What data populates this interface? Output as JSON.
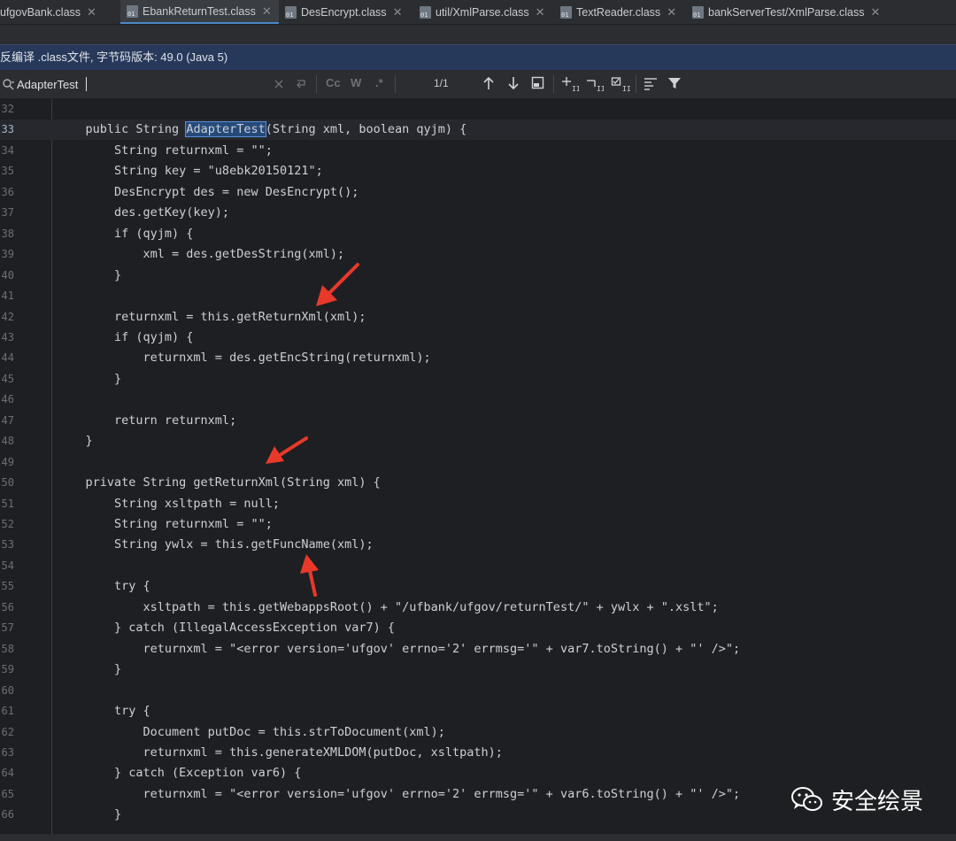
{
  "tabs": [
    {
      "label": "ufgovBank.class",
      "active": false
    },
    {
      "label": "EbankReturnTest.class",
      "active": true
    },
    {
      "label": "DesEncrypt.class",
      "active": false
    },
    {
      "label": "util/XmlParse.class",
      "active": false
    },
    {
      "label": "TextReader.class",
      "active": false
    },
    {
      "label": "bankServerTest/XmlParse.class",
      "active": false
    }
  ],
  "file_icon_label": "01",
  "close_glyph": "✕",
  "banner": "反编译 .class文件, 字节码版本: 49.0 (Java 5)",
  "search": {
    "value": "AdapterTest",
    "match_case": "Cc",
    "whole_words": "W",
    "regex": ".*",
    "result_count": "1/1"
  },
  "code_lines": [
    {
      "num": "32",
      "text": ""
    },
    {
      "num": "33",
      "text": "    public String ",
      "match": "AdapterTest",
      "after": "(String xml, boolean qyjm) {"
    },
    {
      "num": "34",
      "text": "        String returnxml = \"\";"
    },
    {
      "num": "35",
      "text": "        String key = \"u8ebk20150121\";"
    },
    {
      "num": "36",
      "text": "        DesEncrypt des = new DesEncrypt();"
    },
    {
      "num": "37",
      "text": "        des.getKey(key);"
    },
    {
      "num": "38",
      "text": "        if (qyjm) {"
    },
    {
      "num": "39",
      "text": "            xml = des.getDesString(xml);"
    },
    {
      "num": "40",
      "text": "        }"
    },
    {
      "num": "41",
      "text": ""
    },
    {
      "num": "42",
      "text": "        returnxml = this.getReturnXml(xml);"
    },
    {
      "num": "43",
      "text": "        if (qyjm) {"
    },
    {
      "num": "44",
      "text": "            returnxml = des.getEncString(returnxml);"
    },
    {
      "num": "45",
      "text": "        }"
    },
    {
      "num": "46",
      "text": ""
    },
    {
      "num": "47",
      "text": "        return returnxml;"
    },
    {
      "num": "48",
      "text": "    }"
    },
    {
      "num": "49",
      "text": ""
    },
    {
      "num": "50",
      "text": "    private String getReturnXml(String xml) {"
    },
    {
      "num": "51",
      "text": "        String xsltpath = null;"
    },
    {
      "num": "52",
      "text": "        String returnxml = \"\";"
    },
    {
      "num": "53",
      "text": "        String ywlx = this.getFuncName(xml);"
    },
    {
      "num": "54",
      "text": ""
    },
    {
      "num": "55",
      "text": "        try {"
    },
    {
      "num": "56",
      "text": "            xsltpath = this.getWebappsRoot() + \"/ufbank/ufgov/returnTest/\" + ywlx + \".xslt\";"
    },
    {
      "num": "57",
      "text": "        } catch (IllegalAccessException var7) {"
    },
    {
      "num": "58",
      "text": "            returnxml = \"<error version='ufgov' errno='2' errmsg='\" + var7.toString() + \"' />\";"
    },
    {
      "num": "59",
      "text": "        }"
    },
    {
      "num": "60",
      "text": ""
    },
    {
      "num": "61",
      "text": "        try {"
    },
    {
      "num": "62",
      "text": "            Document putDoc = this.strToDocument(xml);"
    },
    {
      "num": "63",
      "text": "            returnxml = this.generateXMLDOM(putDoc, xsltpath);"
    },
    {
      "num": "64",
      "text": "        } catch (Exception var6) {"
    },
    {
      "num": "65",
      "text": "            returnxml = \"<error version='ufgov' errno='2' errmsg='\" + var6.toString() + \"' />\";"
    },
    {
      "num": "66",
      "text": "        }"
    }
  ],
  "watermark": "安全绘景",
  "colors": {
    "background": "#1e1f22",
    "banner": "#27395a",
    "match_highlight": "#254a7a",
    "arrow": "#e8392a"
  }
}
